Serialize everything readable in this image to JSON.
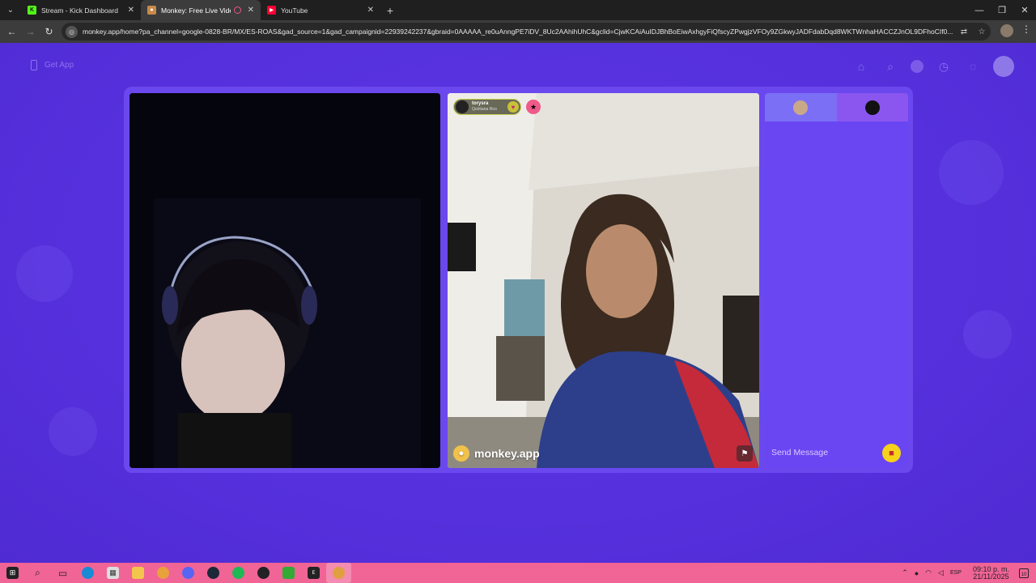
{
  "browser": {
    "tabs": [
      {
        "title": "Stream - Kick Dashboard",
        "icon": "kick-icon",
        "active": false
      },
      {
        "title": "Monkey: Free Live Video Ch",
        "icon": "monkey-icon",
        "active": true
      },
      {
        "title": "YouTube",
        "icon": "youtube-icon",
        "active": false
      }
    ],
    "url": "monkey.app/home?pa_channel=google-0828-BR/MX/ES-ROAS&gad_source=1&gad_campaignid=22939242237&gbraid=0AAAAA_re0uAnngPE7iDV_8Uc2AAhihUhC&gclid=CjwKCAiAuIDJBhBoEiwAxhgyFiQfscyZPwgjzVFOy9ZGkwyJADFdabDqd8WKTWnhaHACCZJnOL9DFhoCIf0..."
  },
  "site": {
    "get_app_label": "Get App",
    "top_icons": [
      "hat-icon",
      "search-icon",
      "coin-icon",
      "history-icon",
      "chat-icon",
      "profile-avatar-icon"
    ]
  },
  "stranger": {
    "username": "torysra",
    "location": "Quintana Roo"
  },
  "watermark": "monkey.app",
  "chat": {
    "placeholder": "Send Message"
  },
  "taskbar": {
    "apps": [
      "windows-start-icon",
      "search-icon",
      "task-view-icon",
      "edge-icon",
      "store-icon",
      "file-explorer-icon",
      "chrome-icon",
      "discord-icon",
      "steam-icon",
      "spotify-icon",
      "obs-icon",
      "xbox-icon",
      "epic-games-icon",
      "chrome-active-icon"
    ],
    "language": "ESP",
    "time": "09:10 p. m.",
    "date": "21/11/2025",
    "notifications": "10"
  },
  "colors": {
    "page_bg": "#5a33e0",
    "panel": "#6a46f2",
    "taskbar": "#f06496",
    "gift": "#f6d21b"
  }
}
